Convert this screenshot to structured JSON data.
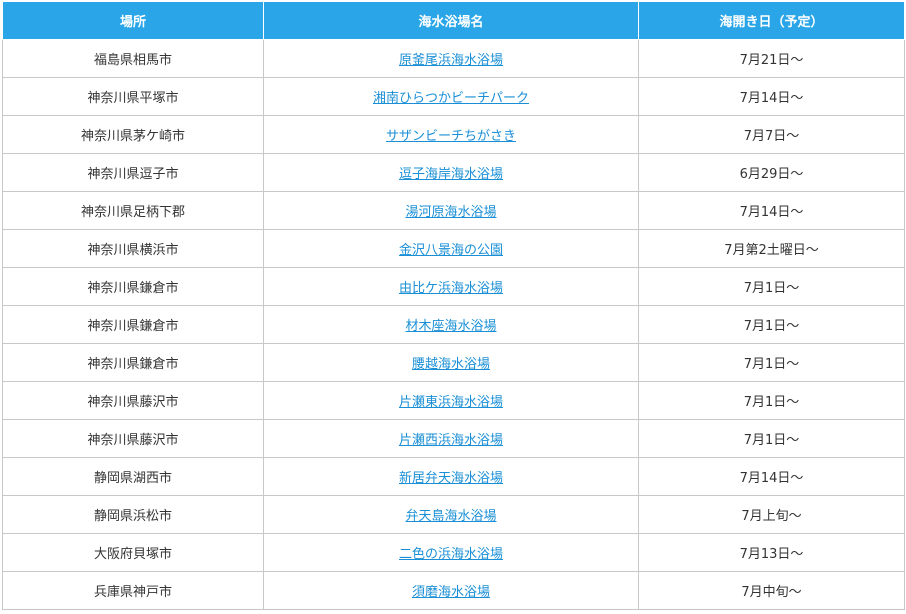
{
  "table": {
    "headers": [
      "場所",
      "海水浴場名",
      "海開き日（予定）"
    ],
    "rows": [
      {
        "place": "福島県相馬市",
        "beach": "原釜尾浜海水浴場",
        "date": "7月21日〜"
      },
      {
        "place": "神奈川県平塚市",
        "beach": "湘南ひらつかビーチパーク",
        "date": "7月14日〜"
      },
      {
        "place": "神奈川県茅ケ崎市",
        "beach": "サザンビーチちがさき",
        "date": "7月7日〜"
      },
      {
        "place": "神奈川県逗子市",
        "beach": "逗子海岸海水浴場",
        "date": "6月29日〜"
      },
      {
        "place": "神奈川県足柄下郡",
        "beach": "湯河原海水浴場",
        "date": "7月14日〜"
      },
      {
        "place": "神奈川県横浜市",
        "beach": "金沢八景海の公園",
        "date": "7月第2土曜日〜"
      },
      {
        "place": "神奈川県鎌倉市",
        "beach": "由比ケ浜海水浴場",
        "date": "7月1日〜"
      },
      {
        "place": "神奈川県鎌倉市",
        "beach": "材木座海水浴場",
        "date": "7月1日〜"
      },
      {
        "place": "神奈川県鎌倉市",
        "beach": "腰越海水浴場",
        "date": "7月1日〜"
      },
      {
        "place": "神奈川県藤沢市",
        "beach": "片瀬東浜海水浴場",
        "date": "7月1日〜"
      },
      {
        "place": "神奈川県藤沢市",
        "beach": "片瀬西浜海水浴場",
        "date": "7月1日〜"
      },
      {
        "place": "静岡県湖西市",
        "beach": "新居弁天海水浴場",
        "date": "7月14日〜"
      },
      {
        "place": "静岡県浜松市",
        "beach": "弁天島海水浴場",
        "date": "7月上旬〜"
      },
      {
        "place": "大阪府貝塚市",
        "beach": "二色の浜海水浴場",
        "date": "7月13日〜"
      },
      {
        "place": "兵庫県神戸市",
        "beach": "須磨海水浴場",
        "date": "7月中旬〜"
      }
    ]
  },
  "colors": {
    "header_bg": "#2aa6e8",
    "link": "#1a8fd6",
    "border": "#c8c8c8"
  }
}
